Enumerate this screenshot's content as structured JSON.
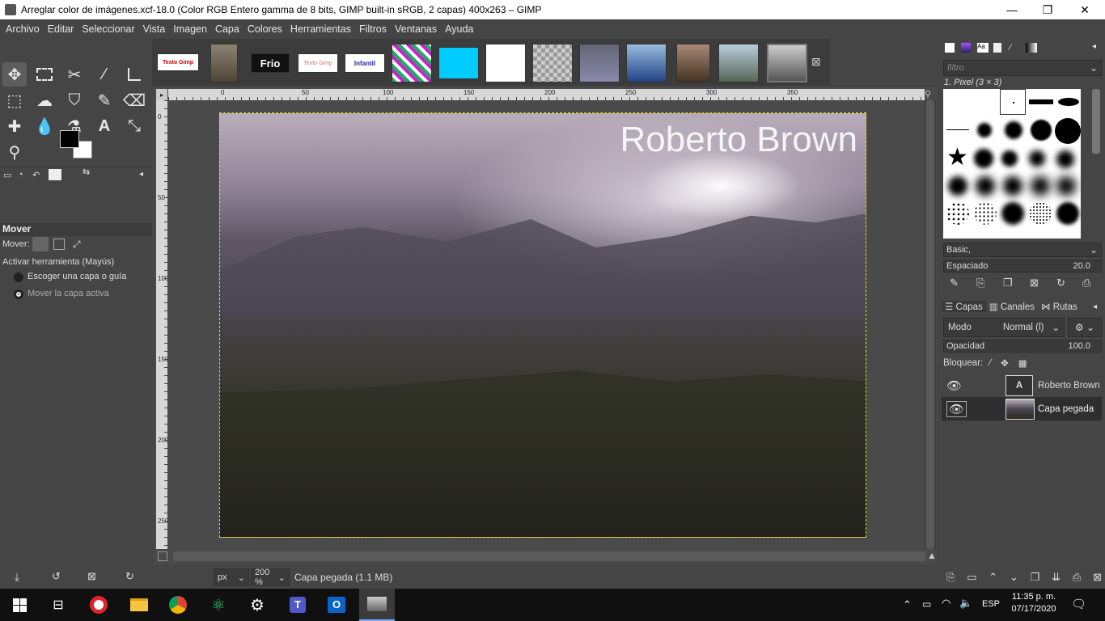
{
  "window": {
    "title": "Arreglar color de imágenes.xcf-18.0 (Color RGB Entero gamma de 8 bits, GIMP built-in sRGB, 2 capas) 400x263 – GIMP",
    "min": "—",
    "max": "❐",
    "close": "✕"
  },
  "menu": [
    "Archivo",
    "Editar",
    "Seleccionar",
    "Vista",
    "Imagen",
    "Capa",
    "Colores",
    "Herramientas",
    "Filtros",
    "Ventanas",
    "Ayuda"
  ],
  "tool_options": {
    "title": "Mover",
    "mover_label": "Mover:",
    "toggle_label": "Activar herramienta  (Mayús)",
    "option1": "Escoger una capa o guía",
    "option2": "Mover la capa activa"
  },
  "image_tabs": {
    "thumb_texts": [
      "Texto Gimp",
      "",
      "Frio",
      "Texto Gimp",
      "Infantil"
    ],
    "close_icon": "⊠"
  },
  "rulers": {
    "top": [
      "0",
      "50",
      "100",
      "150",
      "200",
      "250",
      "300",
      "350"
    ],
    "left": [
      "0",
      "50",
      "100",
      "150",
      "200",
      "250"
    ]
  },
  "canvas": {
    "watermark_text": "Roberto Brown"
  },
  "statusbar": {
    "unit": "px",
    "zoom": "200 %",
    "layer_info": "Capa pegada (1.1 MB)"
  },
  "brushes": {
    "filter_placeholder": "filtro",
    "selected_brush": "1. Pixel (3 × 3)",
    "preset": "Basic,",
    "spacing_label": "Espaciado",
    "spacing_value": "20.0"
  },
  "layers_panel": {
    "tabs": [
      "Capas",
      "Canales",
      "Rutas"
    ],
    "mode_label": "Modo",
    "mode_value": "Normal (l)",
    "opacity_label": "Opacidad",
    "opacity_value": "100.0",
    "lock_label": "Bloquear:",
    "layers": [
      {
        "name": "Roberto Brown",
        "visible": true
      },
      {
        "name": "Capa pegada",
        "visible": true
      }
    ]
  },
  "taskbar": {
    "lang": "ESP",
    "time": "11:35 p. m.",
    "date": "07/17/2020"
  },
  "colors": {
    "accent_selection": "#f0e000",
    "ui_bg": "#454545"
  }
}
